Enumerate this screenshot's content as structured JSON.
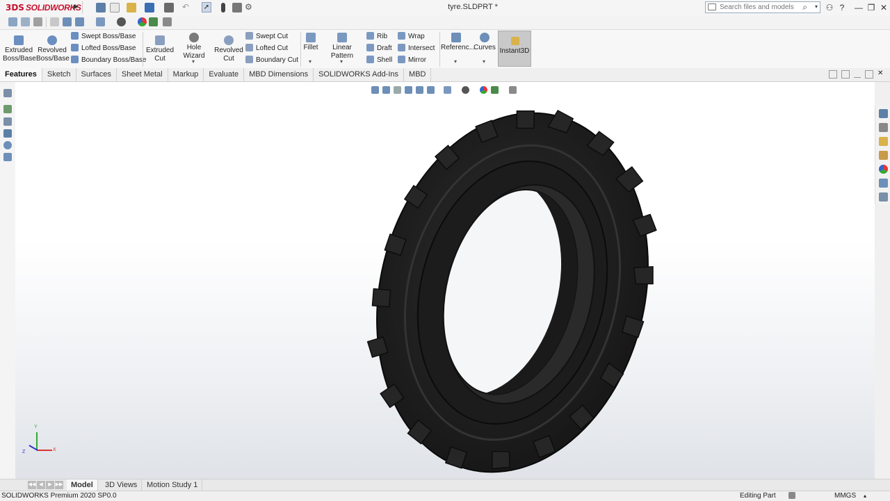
{
  "app": {
    "brand_prefix": "3DS",
    "brand_name": "SOLIDWORKS",
    "brand_color": "#c8102e"
  },
  "window": {
    "document_title": "tyre.SLDPRT *"
  },
  "search": {
    "placeholder": "Search files and models"
  },
  "title_controls": {
    "user_icon": "user-icon",
    "help": "?",
    "minimize": "—",
    "restore": "❐",
    "close": "✕"
  },
  "ribbon": {
    "extruded_boss": "Extruded Boss/Base",
    "revolved_boss": "Revolved Boss/Base",
    "swept_boss": "Swept Boss/Base",
    "lofted_boss": "Lofted Boss/Base",
    "boundary_boss": "Boundary Boss/Base",
    "extruded_cut": "Extruded Cut",
    "hole_wizard": "Hole Wizard",
    "revolved_cut": "Revolved Cut",
    "swept_cut": "Swept Cut",
    "lofted_cut": "Lofted Cut",
    "boundary_cut": "Boundary Cut",
    "fillet": "Fillet",
    "linear_pattern": "Linear Pattern",
    "rib": "Rib",
    "draft": "Draft",
    "shell": "Shell",
    "wrap": "Wrap",
    "intersect": "Intersect",
    "mirror": "Mirror",
    "reference": "Referenc...",
    "curves": "Curves",
    "instant3d": "Instant3D"
  },
  "tabs": [
    "Features",
    "Sketch",
    "Surfaces",
    "Sheet Metal",
    "Markup",
    "Evaluate",
    "MBD Dimensions",
    "SOLIDWORKS Add-Ins",
    "MBD"
  ],
  "active_tab": "Features",
  "triad": {
    "x": "X",
    "y": "Y",
    "z": "Z"
  },
  "bottom_tabs": {
    "model": "Model",
    "views3d": "3D Views",
    "motion": "Motion Study 1"
  },
  "status": {
    "product": "SOLIDWORKS Premium 2020 SP0.0",
    "mode": "Editing Part",
    "units": "MMGS"
  },
  "colors": {
    "accent": "#c8102e",
    "tyre": "#1f1f1f",
    "active_tool": "#c9c9c9"
  }
}
